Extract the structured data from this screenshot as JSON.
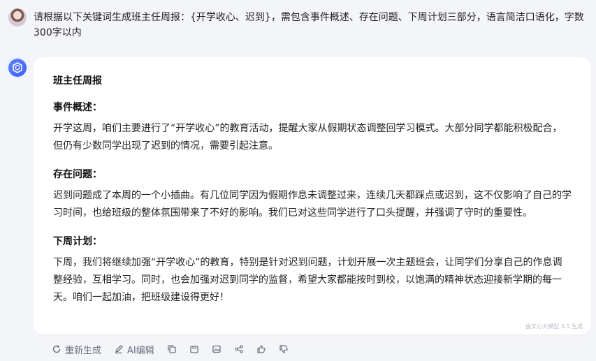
{
  "user_prompt": "请根据以下关键词生成班主任周报：{开学收心、迟到}，需包含事件概述、存在问题、下周计划三部分，语言简洁口语化，字数300字以内",
  "response": {
    "title": "班主任周报",
    "sections": [
      {
        "heading": "事件概述：",
        "body": "开学这周，咱们主要进行了“开学收心”的教育活动，提醒大家从假期状态调整回学习模式。大部分同学都能积极配合，但仍有少数同学出现了迟到的情况，需要引起注意。"
      },
      {
        "heading": "存在问题：",
        "body": "迟到问题成了本周的一个小插曲。有几位同学因为假期作息未调整过来，连续几天都踩点或迟到，这不仅影响了自己的学习时间，也给班级的整体氛围带来了不好的影响。我们已对这些同学进行了口头提醒，并强调了守时的重要性。"
      },
      {
        "heading": "下周计划：",
        "body": "下周，我们将继续加强“开学收心”的教育，特别是针对迟到问题，计划开展一次主题班会，让同学们分享自己的作息调整经验，互相学习。同时，也会加强对迟到同学的监督，希望大家都能按时到校，以饱满的精神状态迎接新学期的每一天。咱们一起加油，把班级建设得更好！"
      }
    ],
    "watermark": "由文心大模型 3.5 生成"
  },
  "toolbar": {
    "regenerate": "重新生成",
    "ai_edit": "AI编辑"
  },
  "icons": [
    "refresh-icon",
    "edit-icon",
    "copy-icon",
    "save-icon",
    "image-icon",
    "share-icon",
    "thumbs-up-icon",
    "thumbs-down-icon"
  ],
  "colors": {
    "background": "#f4f5f9",
    "card": "#ffffff",
    "accent": "#4e6bff",
    "toolbar_text": "#6b6f80"
  }
}
